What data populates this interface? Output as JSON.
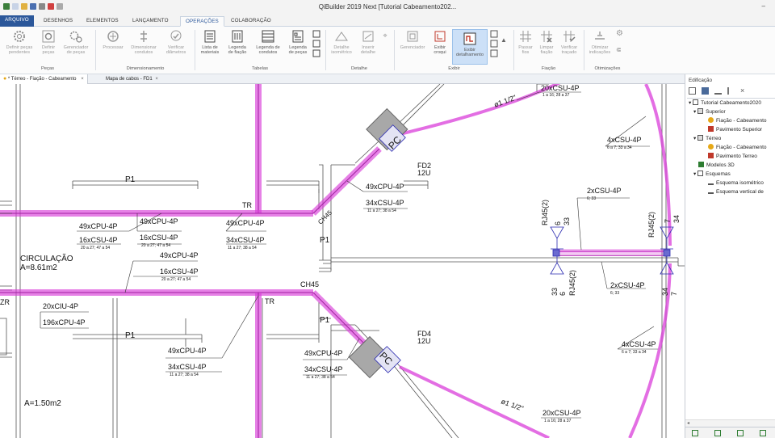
{
  "window": {
    "title": "QiBuilder 2019 Next [Tutorial Cabeamento202...",
    "minimize": "–"
  },
  "ribbon_tabs": [
    "ARQUIVO",
    "DESENHOS",
    "ELEMENTOS",
    "LANÇAMENTO",
    "OPERAÇÕES",
    "COLABORAÇÃO"
  ],
  "active_tab": "OPERAÇÕES",
  "ribbon": {
    "pecas": {
      "group": "Peças",
      "b1": "Definir peças",
      "b1b": "pendentes",
      "b2": "Definir",
      "b2b": "peças",
      "b3": "Gerenciador",
      "b3b": "de peças"
    },
    "dimensionamento": {
      "group": "Dimensionamento",
      "b1": "Processar",
      "b2": "Dimensionar",
      "b2b": "condutos",
      "b3": "Verificar",
      "b3b": "diâmetros"
    },
    "tabelas": {
      "group": "Tabelas",
      "b1": "Lista de",
      "b1b": "materiais",
      "b2": "Legenda",
      "b2b": "de fiação",
      "b3": "Legenda de",
      "b3b": "condutos",
      "b4": "Legenda",
      "b4b": "de peças"
    },
    "detalhe": {
      "group": "Detalhe",
      "b1": "Detalhe",
      "b1b": "isométrico",
      "b2": "Inserir",
      "b2b": "detalhe"
    },
    "exibir": {
      "group": "Exibir",
      "b1": "Gerenciador",
      "b2": "Exibir",
      "b2b": "croqui",
      "b3": "Exibir",
      "b3b": "detalhamento"
    },
    "fiacao": {
      "group": "Fiação",
      "b1": "Passar",
      "b1b": "fios",
      "b2": "Limpar",
      "b2b": "fiação",
      "b3": "Verificar",
      "b3b": "traçado"
    },
    "otimizacoes": {
      "group": "Otimizações",
      "b1": "Otimizar",
      "b1b": "indicações"
    }
  },
  "doc_tabs": [
    {
      "label": "* Térreo - Fiação - Cabeamento"
    },
    {
      "label": "Mapa de cabos - FD1"
    }
  ],
  "sidebar": {
    "title": "Edificação",
    "tree": [
      {
        "label": "Tutorial Cabeamento2020"
      },
      {
        "label": "Superior"
      },
      {
        "label": "Fiação - Cabeamento"
      },
      {
        "label": "Pavimento Superior"
      },
      {
        "label": "Térreo"
      },
      {
        "label": "Fiação - Cabeamento"
      },
      {
        "label": "Pavimento Terreo"
      },
      {
        "label": "Modelos 3D"
      },
      {
        "label": "Esquemas"
      },
      {
        "label": "Esquema isométrico"
      },
      {
        "label": "Esquema vertical de"
      }
    ]
  },
  "drawing": {
    "room1": "CIRCULAÇÃO",
    "room1_area": "A=8.61m2",
    "room2_area": "A=1.50m2",
    "p1": "P1",
    "tr": "TR",
    "ch45": "CH45",
    "zr": "ZR",
    "pc": "PC",
    "fd2": "FD2",
    "fd2_u": "12U",
    "fd4": "FD4",
    "fd4_u": "12U",
    "c49cpu": "49xCPU-4P",
    "c34csu": "34xCSU-4P",
    "c16csu": "16xCSU-4P",
    "c20ciu": "20xCIU-4P",
    "c196cpu": "196xCPU-4P",
    "c20csu": "20xCSU-4P",
    "c4csu": "4xCSU-4P",
    "c2csu": "2xCSU-4P",
    "sub_a": "11 a 27; 38 a 54",
    "sub_b": "20 a 27; 47 a 54",
    "sub_c": "1 a 16; 28 a 37",
    "sub_d": "6 a 7; 33 a 34",
    "sub_e": "6; 33",
    "d112": "ø1 1/2\"",
    "rj45": "RJ45(2)",
    "n6": "6",
    "n33": "33",
    "n7": "7",
    "n34": "34"
  }
}
